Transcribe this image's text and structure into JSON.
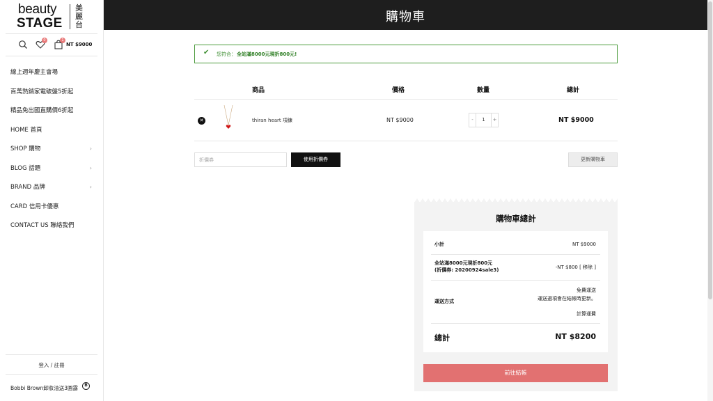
{
  "sidebar": {
    "logo": {
      "line1": "beauty",
      "line2": "STAGE",
      "cjk": "美麗台"
    },
    "wishlist_count": "0",
    "cart_count": "1",
    "cart_total": "NT $9000",
    "menu": [
      {
        "label": "線上週年慶主會場",
        "has_arrow": false
      },
      {
        "label": "百萬熱銷家電破盤5折起",
        "has_arrow": false
      },
      {
        "label": "精品免出國直購價6折起",
        "has_arrow": false
      },
      {
        "label": "HOME 首頁",
        "has_arrow": false
      },
      {
        "label": "SHOP 購物",
        "has_arrow": true
      },
      {
        "label": "BLOG 話題",
        "has_arrow": true
      },
      {
        "label": "BRAND 品牌",
        "has_arrow": true
      },
      {
        "label": "CARD 信用卡優惠",
        "has_arrow": false
      },
      {
        "label": "CONTACT US 聯絡我們",
        "has_arrow": false
      }
    ],
    "login_label": "登入 / 註冊",
    "promo_text": "Bobbi Brown卸妝油送3圓露",
    "promo_icon": "circle-B"
  },
  "header": {
    "title": "購物車"
  },
  "notice": {
    "prefix": "您符合：",
    "message": "全站滿8000元現折800元!",
    "color": "#3f8f33"
  },
  "cart": {
    "columns": {
      "product": "商品",
      "price": "價格",
      "quantity": "數量",
      "total": "總計"
    },
    "items": [
      {
        "name": "thiran heart 項鍊",
        "price": "NT $9000",
        "quantity": "1",
        "total": "NT $9000"
      }
    ],
    "coupon_placeholder": "折價券",
    "apply_coupon_label": "使用折價券",
    "update_cart_label": "更新購物車"
  },
  "totals": {
    "heading": "購物車總計",
    "subtotal_label": "小計",
    "subtotal_value": "NT $9000",
    "discount_label_line1": "全站滿8000元現折800元",
    "discount_label_line2": "(折價券: 20200924sale3)",
    "discount_value": "-NT $800 [ 移除 ]",
    "shipping_label": "運送方式",
    "shipping_free": "免費運送",
    "shipping_note": "運送選項會在結帳時更新。",
    "shipping_calc": "計算運費",
    "total_label": "總計",
    "total_value": "NT $8200",
    "checkout_label": "前往結帳",
    "checkout_color": "#e27171"
  }
}
